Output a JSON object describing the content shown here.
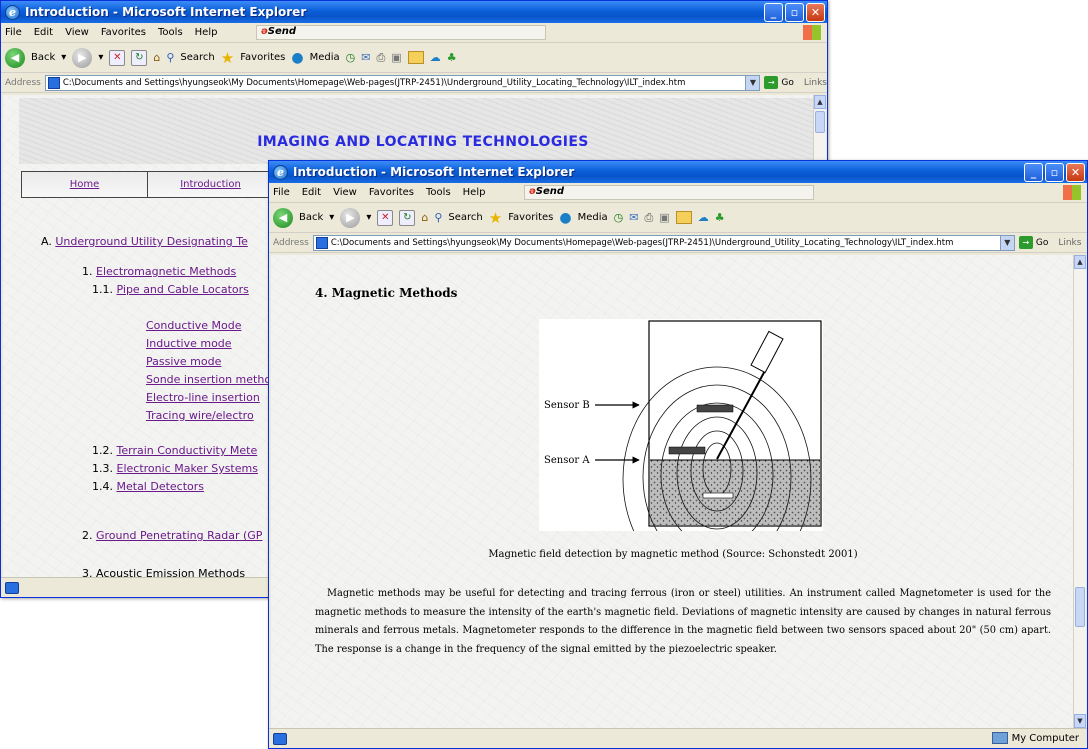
{
  "back_window": {
    "title": "Introduction - Microsoft Internet Explorer",
    "menu": [
      "File",
      "Edit",
      "View",
      "Favorites",
      "Tools",
      "Help"
    ],
    "send_label": "Send",
    "toolbar": {
      "back": "Back",
      "search": "Search",
      "favorites": "Favorites",
      "media": "Media"
    },
    "address_label": "Address",
    "address_url": "C:\\Documents and Settings\\hyungseok\\My Documents\\Homepage\\Web-pages(JTRP-2451)\\Underground_Utility_Locating_Technology\\ILT_index.htm",
    "go_label": "Go",
    "links_label": "Links",
    "page": {
      "heading": "IMAGING AND LOCATING TECHNOLOGIES",
      "nav": [
        "Home",
        "Introduction"
      ],
      "toc": {
        "a_prefix": "A.",
        "a_label": "Underground Utility Designating Te",
        "item1_num": "1.",
        "item1": "Electromagnetic Methods",
        "item11_num": "1.1.",
        "item11": "Pipe and Cable Locators",
        "modes": [
          "Conductive Mode",
          "Inductive mode",
          "Passive mode",
          "Sonde insertion metho",
          "Electro-line insertion",
          "Tracing wire/electro"
        ],
        "item12_num": "1.2.",
        "item12": "Terrain Conductivity Mete",
        "item13_num": "1.3.",
        "item13": "Electronic Maker Systems",
        "item14_num": "1.4.",
        "item14": "Metal Detectors",
        "item2_num": "2.",
        "item2": "Ground Penetrating Radar (GP",
        "item3_partial": "3. Acoustic Emission Methods"
      }
    }
  },
  "front_window": {
    "title": "Introduction - Microsoft Internet Explorer",
    "menu": [
      "File",
      "Edit",
      "View",
      "Favorites",
      "Tools",
      "Help"
    ],
    "send_label": "Send",
    "toolbar": {
      "back": "Back",
      "search": "Search",
      "favorites": "Favorites",
      "media": "Media"
    },
    "address_label": "Address",
    "address_url": "C:\\Documents and Settings\\hyungseok\\My Documents\\Homepage\\Web-pages(JTRP-2451)\\Underground_Utility_Locating_Technology\\ILT_index.htm",
    "go_label": "Go",
    "links_label": "Links",
    "status": "My Computer",
    "page": {
      "section_title": "4. Magnetic Methods",
      "figure": {
        "sensor_b": "Sensor B",
        "sensor_a": "Sensor A"
      },
      "caption": "Magnetic field detection by magnetic method (Source: Schonstedt 2001)",
      "paragraph": "Magnetic methods may be useful for detecting and tracing ferrous (iron or steel) utilities. An instrument called Magnetometer is used for the magnetic methods to measure the intensity of the earth's magnetic field. Deviations of magnetic intensity are caused by changes in natural ferrous minerals and ferrous metals. Magnetometer responds to the difference in the magnetic field between two sensors spaced about 20\" (50 cm) apart.  The response is a change in the frequency of the signal emitted by the piezoelectric speaker."
    }
  },
  "colors": {
    "titlebar": "#0a5fd8",
    "link": "#6a1a8a",
    "heading": "#2a2ae0"
  }
}
